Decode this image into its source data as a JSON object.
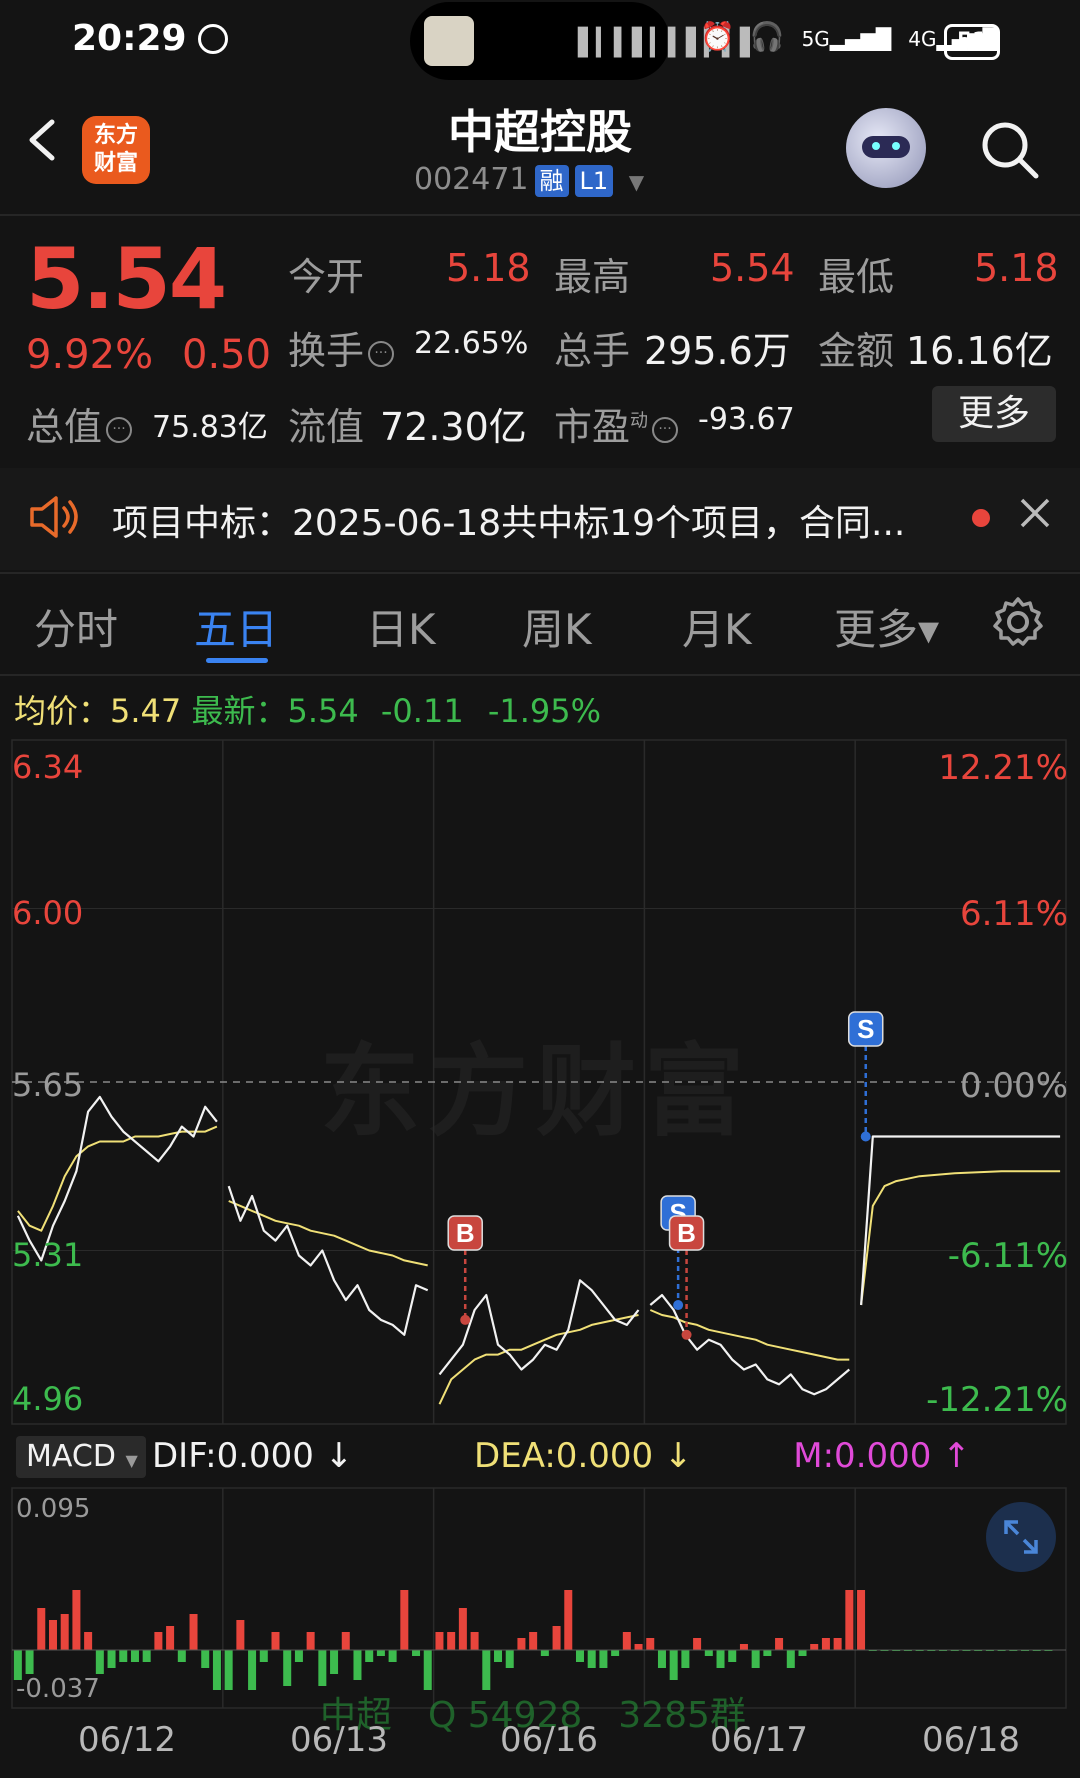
{
  "status_bar": {
    "time": "20:29",
    "battery": "51"
  },
  "header": {
    "logo_text_1": "东方",
    "logo_text_2": "财富",
    "stock_name": "中超控股",
    "stock_code": "002471",
    "tag_rong": "融",
    "tag_level": "L1"
  },
  "quote": {
    "price": "5.54",
    "change_pct": "9.92%",
    "change_amt": "0.50",
    "open_label": "今开",
    "open": "5.18",
    "high_label": "最高",
    "high": "5.54",
    "low_label": "最低",
    "low": "5.18",
    "turnover_label": "换手",
    "turnover": "22.65%",
    "volume_label": "总手",
    "volume": "295.6万",
    "amount_label": "金额",
    "amount": "16.16亿",
    "mktcap_label": "总值",
    "mktcap": "75.83亿",
    "float_label": "流值",
    "float_cap": "72.30亿",
    "pe_label": "市盈",
    "pe_sup": "动",
    "pe": "-93.67",
    "more": "更多"
  },
  "news": {
    "text": "项目中标：2025-06-18共中标19个项目，合同..."
  },
  "tabs": [
    {
      "label": "分时"
    },
    {
      "label": "五日"
    },
    {
      "label": "日K"
    },
    {
      "label": "周K"
    },
    {
      "label": "月K"
    },
    {
      "label": "更多▾"
    }
  ],
  "info_line": {
    "avg_label": "均价：",
    "avg": "5.47",
    "latest_label": "最新：",
    "latest": "5.54",
    "chg": "-0.11",
    "chg_pct": "-1.95%"
  },
  "chart_data": {
    "type": "line",
    "title": "",
    "y_left_ticks": [
      "6.34",
      "6.00",
      "5.65",
      "5.31",
      "4.96"
    ],
    "y_right_ticks": [
      "12.21%",
      "6.11%",
      "0.00%",
      "-6.11%",
      "-12.21%"
    ],
    "ylim": [
      4.96,
      6.34
    ],
    "x_categories": [
      "06/12",
      "06/13",
      "06/16",
      "06/17",
      "06/18"
    ],
    "prev_close": 5.65,
    "series": [],
    "markers": [
      {
        "label": "B",
        "day": "06/16",
        "price": 5.17
      },
      {
        "label": "S",
        "day": "06/17",
        "price": 5.2
      },
      {
        "label": "B",
        "day": "06/17",
        "price": 5.14
      },
      {
        "label": "S",
        "day": "06/18",
        "price": 5.54
      }
    ],
    "approx_series": {
      "price": [
        5.38,
        5.33,
        5.29,
        5.36,
        5.41,
        5.47,
        5.59,
        5.62,
        5.58,
        5.55,
        5.53,
        5.51,
        5.49,
        5.52,
        5.56,
        5.54,
        5.6,
        5.57,
        5.44,
        5.37,
        5.42,
        5.35,
        5.33,
        5.36,
        5.3,
        5.28,
        5.31,
        5.25,
        5.21,
        5.24,
        5.19,
        5.17,
        5.16,
        5.14,
        5.24,
        5.23,
        5.06,
        5.09,
        5.12,
        5.19,
        5.22,
        5.12,
        5.1,
        5.07,
        5.09,
        5.12,
        5.11,
        5.15,
        5.25,
        5.23,
        5.2,
        5.17,
        5.16,
        5.19,
        5.2,
        5.22,
        5.19,
        5.14,
        5.11,
        5.13,
        5.12,
        5.09,
        5.07,
        5.08,
        5.05,
        5.04,
        5.06,
        5.03,
        5.02,
        5.03,
        5.05,
        5.07,
        5.2,
        5.54,
        5.54,
        5.54,
        5.54,
        5.54,
        5.54,
        5.54,
        5.54,
        5.54,
        5.54,
        5.54,
        5.54,
        5.54,
        5.54,
        5.54,
        5.54,
        5.54
      ],
      "avg": [
        5.39,
        5.36,
        5.35,
        5.4,
        5.46,
        5.5,
        5.52,
        5.53,
        5.53,
        5.53,
        5.54,
        5.54,
        5.54,
        5.545,
        5.55,
        5.55,
        5.55,
        5.56,
        5.41,
        5.4,
        5.39,
        5.38,
        5.37,
        5.365,
        5.36,
        5.35,
        5.345,
        5.34,
        5.33,
        5.32,
        5.31,
        5.305,
        5.3,
        5.29,
        5.285,
        5.28,
        5.0,
        5.05,
        5.07,
        5.09,
        5.1,
        5.1,
        5.11,
        5.11,
        5.12,
        5.13,
        5.14,
        5.145,
        5.15,
        5.16,
        5.165,
        5.17,
        5.175,
        5.18,
        5.19,
        5.18,
        5.175,
        5.165,
        5.16,
        5.15,
        5.145,
        5.14,
        5.135,
        5.13,
        5.12,
        5.115,
        5.11,
        5.105,
        5.1,
        5.095,
        5.09,
        5.09,
        5.2,
        5.4,
        5.44,
        5.45,
        5.455,
        5.46,
        5.462,
        5.464,
        5.466,
        5.467,
        5.468,
        5.469,
        5.47,
        5.47,
        5.47,
        5.47,
        5.47,
        5.47
      ]
    },
    "macd": {
      "label": "MACD",
      "dif": "DIF:0.000",
      "dea": "DEA:0.000",
      "m": "M:0.000",
      "top_tick": "0.095",
      "bottom_tick": "-0.037"
    }
  },
  "watermark": "东方财富",
  "bottom_watermark": "中超　Q 54928　3285群",
  "colors": {
    "up": "#e8453c",
    "down": "#3dbb4e",
    "avg_line": "#f0e077",
    "price_line": "#f2f2f2",
    "accent": "#3a83f1",
    "brand": "#ea5a1e"
  }
}
